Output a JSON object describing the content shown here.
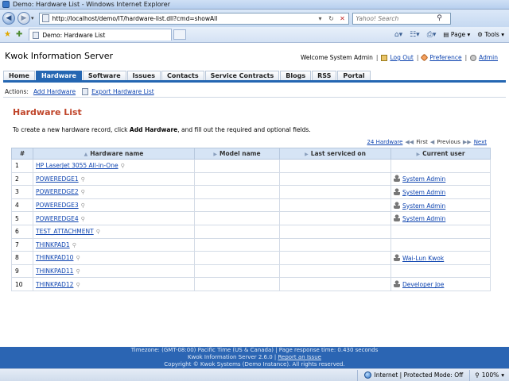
{
  "window": {
    "title": "Demo: Hardware List - Windows Internet Explorer"
  },
  "address": {
    "url": "http://localhost/demo/IT/hardware-list.dll?cmd=showAll",
    "search_placeholder": "Yahoo! Search"
  },
  "browser_tab": {
    "label": "Demo: Hardware List"
  },
  "commands": {
    "page": "Page",
    "tools": "Tools"
  },
  "header": {
    "brand": "Kwok Information Server",
    "welcome": "Welcome System Admin",
    "logout": "Log Out",
    "preference": "Preference",
    "admin": "Admin"
  },
  "nav": {
    "items": [
      {
        "label": "Home",
        "active": false
      },
      {
        "label": "Hardware",
        "active": true
      },
      {
        "label": "Software",
        "active": false
      },
      {
        "label": "Issues",
        "active": false
      },
      {
        "label": "Contacts",
        "active": false
      },
      {
        "label": "Service Contracts",
        "active": false
      },
      {
        "label": "Blogs",
        "active": false
      },
      {
        "label": "RSS",
        "active": false
      },
      {
        "label": "Portal",
        "active": false
      }
    ]
  },
  "actions": {
    "label": "Actions:",
    "add": "Add Hardware",
    "export": "Export Hardware List"
  },
  "page": {
    "title": "Hardware List",
    "intro_before": "To create a new hardware record, click ",
    "intro_bold": "Add Hardware",
    "intro_after": ", and fill out the required and optional fields."
  },
  "pager": {
    "count": "24 Hardware",
    "first": "First",
    "previous": "Previous",
    "next": "Next"
  },
  "table": {
    "columns": [
      "#",
      "Hardware name",
      "Model name",
      "Last serviced on",
      "Current user"
    ],
    "rows": [
      {
        "num": "1",
        "name": "HP LaserJet 3055 All-in-One",
        "model": "",
        "serviced": "",
        "user": ""
      },
      {
        "num": "2",
        "name": "POWEREDGE1",
        "model": "",
        "serviced": "",
        "user": "System Admin"
      },
      {
        "num": "3",
        "name": "POWEREDGE2",
        "model": "",
        "serviced": "",
        "user": "System Admin"
      },
      {
        "num": "4",
        "name": "POWEREDGE3",
        "model": "",
        "serviced": "",
        "user": "System Admin"
      },
      {
        "num": "5",
        "name": "POWEREDGE4",
        "model": "",
        "serviced": "",
        "user": "System Admin"
      },
      {
        "num": "6",
        "name": "TEST_ATTACHMENT",
        "model": "",
        "serviced": "",
        "user": ""
      },
      {
        "num": "7",
        "name": "THINKPAD1",
        "model": "",
        "serviced": "",
        "user": ""
      },
      {
        "num": "8",
        "name": "THINKPAD10",
        "model": "",
        "serviced": "",
        "user": "Wai-Lun Kwok"
      },
      {
        "num": "9",
        "name": "THINKPAD11",
        "model": "",
        "serviced": "",
        "user": ""
      },
      {
        "num": "10",
        "name": "THINKPAD12",
        "model": "",
        "serviced": "",
        "user": "Developer Joe"
      }
    ]
  },
  "footer": {
    "line1": "Timezone: (GMT-08:00) Pacific Time (US & Canada) | Page response time: 0.430 seconds",
    "line2_prefix": "Kwok Information Server 2.6.0 | ",
    "report": "Report an Issue",
    "line3": "Copyright © Kwok Systems (Demo Instance). All rights reserved."
  },
  "status": {
    "zone": "Internet | Protected Mode: Off",
    "zoom": "100%"
  },
  "colors": {
    "accent": "#2466b2",
    "heading": "#c0452a",
    "link": "#0e44b0"
  }
}
